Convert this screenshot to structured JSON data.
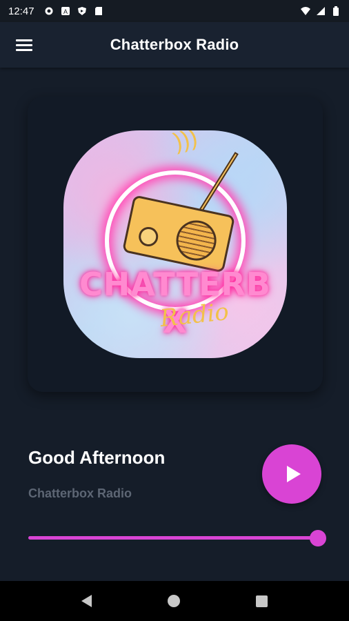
{
  "status_bar": {
    "time": "12:47",
    "left_icons": [
      "gear-icon",
      "text-icon",
      "shield-icon",
      "sd-card-icon"
    ],
    "right_icons": [
      "wifi-icon",
      "signal-icon",
      "battery-icon"
    ]
  },
  "app_bar": {
    "title": "Chatterbox Radio",
    "menu_icon": "hamburger-menu-icon"
  },
  "artwork": {
    "logo_main": "CHATTERB X",
    "logo_script": "Radio"
  },
  "player": {
    "track_title": "Good Afternoon",
    "artist": "Chatterbox Radio",
    "play_icon": "play-icon",
    "volume": 1.0,
    "accent_color": "#d944d4"
  },
  "nav_bar": {
    "icons": [
      "back-icon",
      "home-icon",
      "recent-apps-icon"
    ]
  }
}
